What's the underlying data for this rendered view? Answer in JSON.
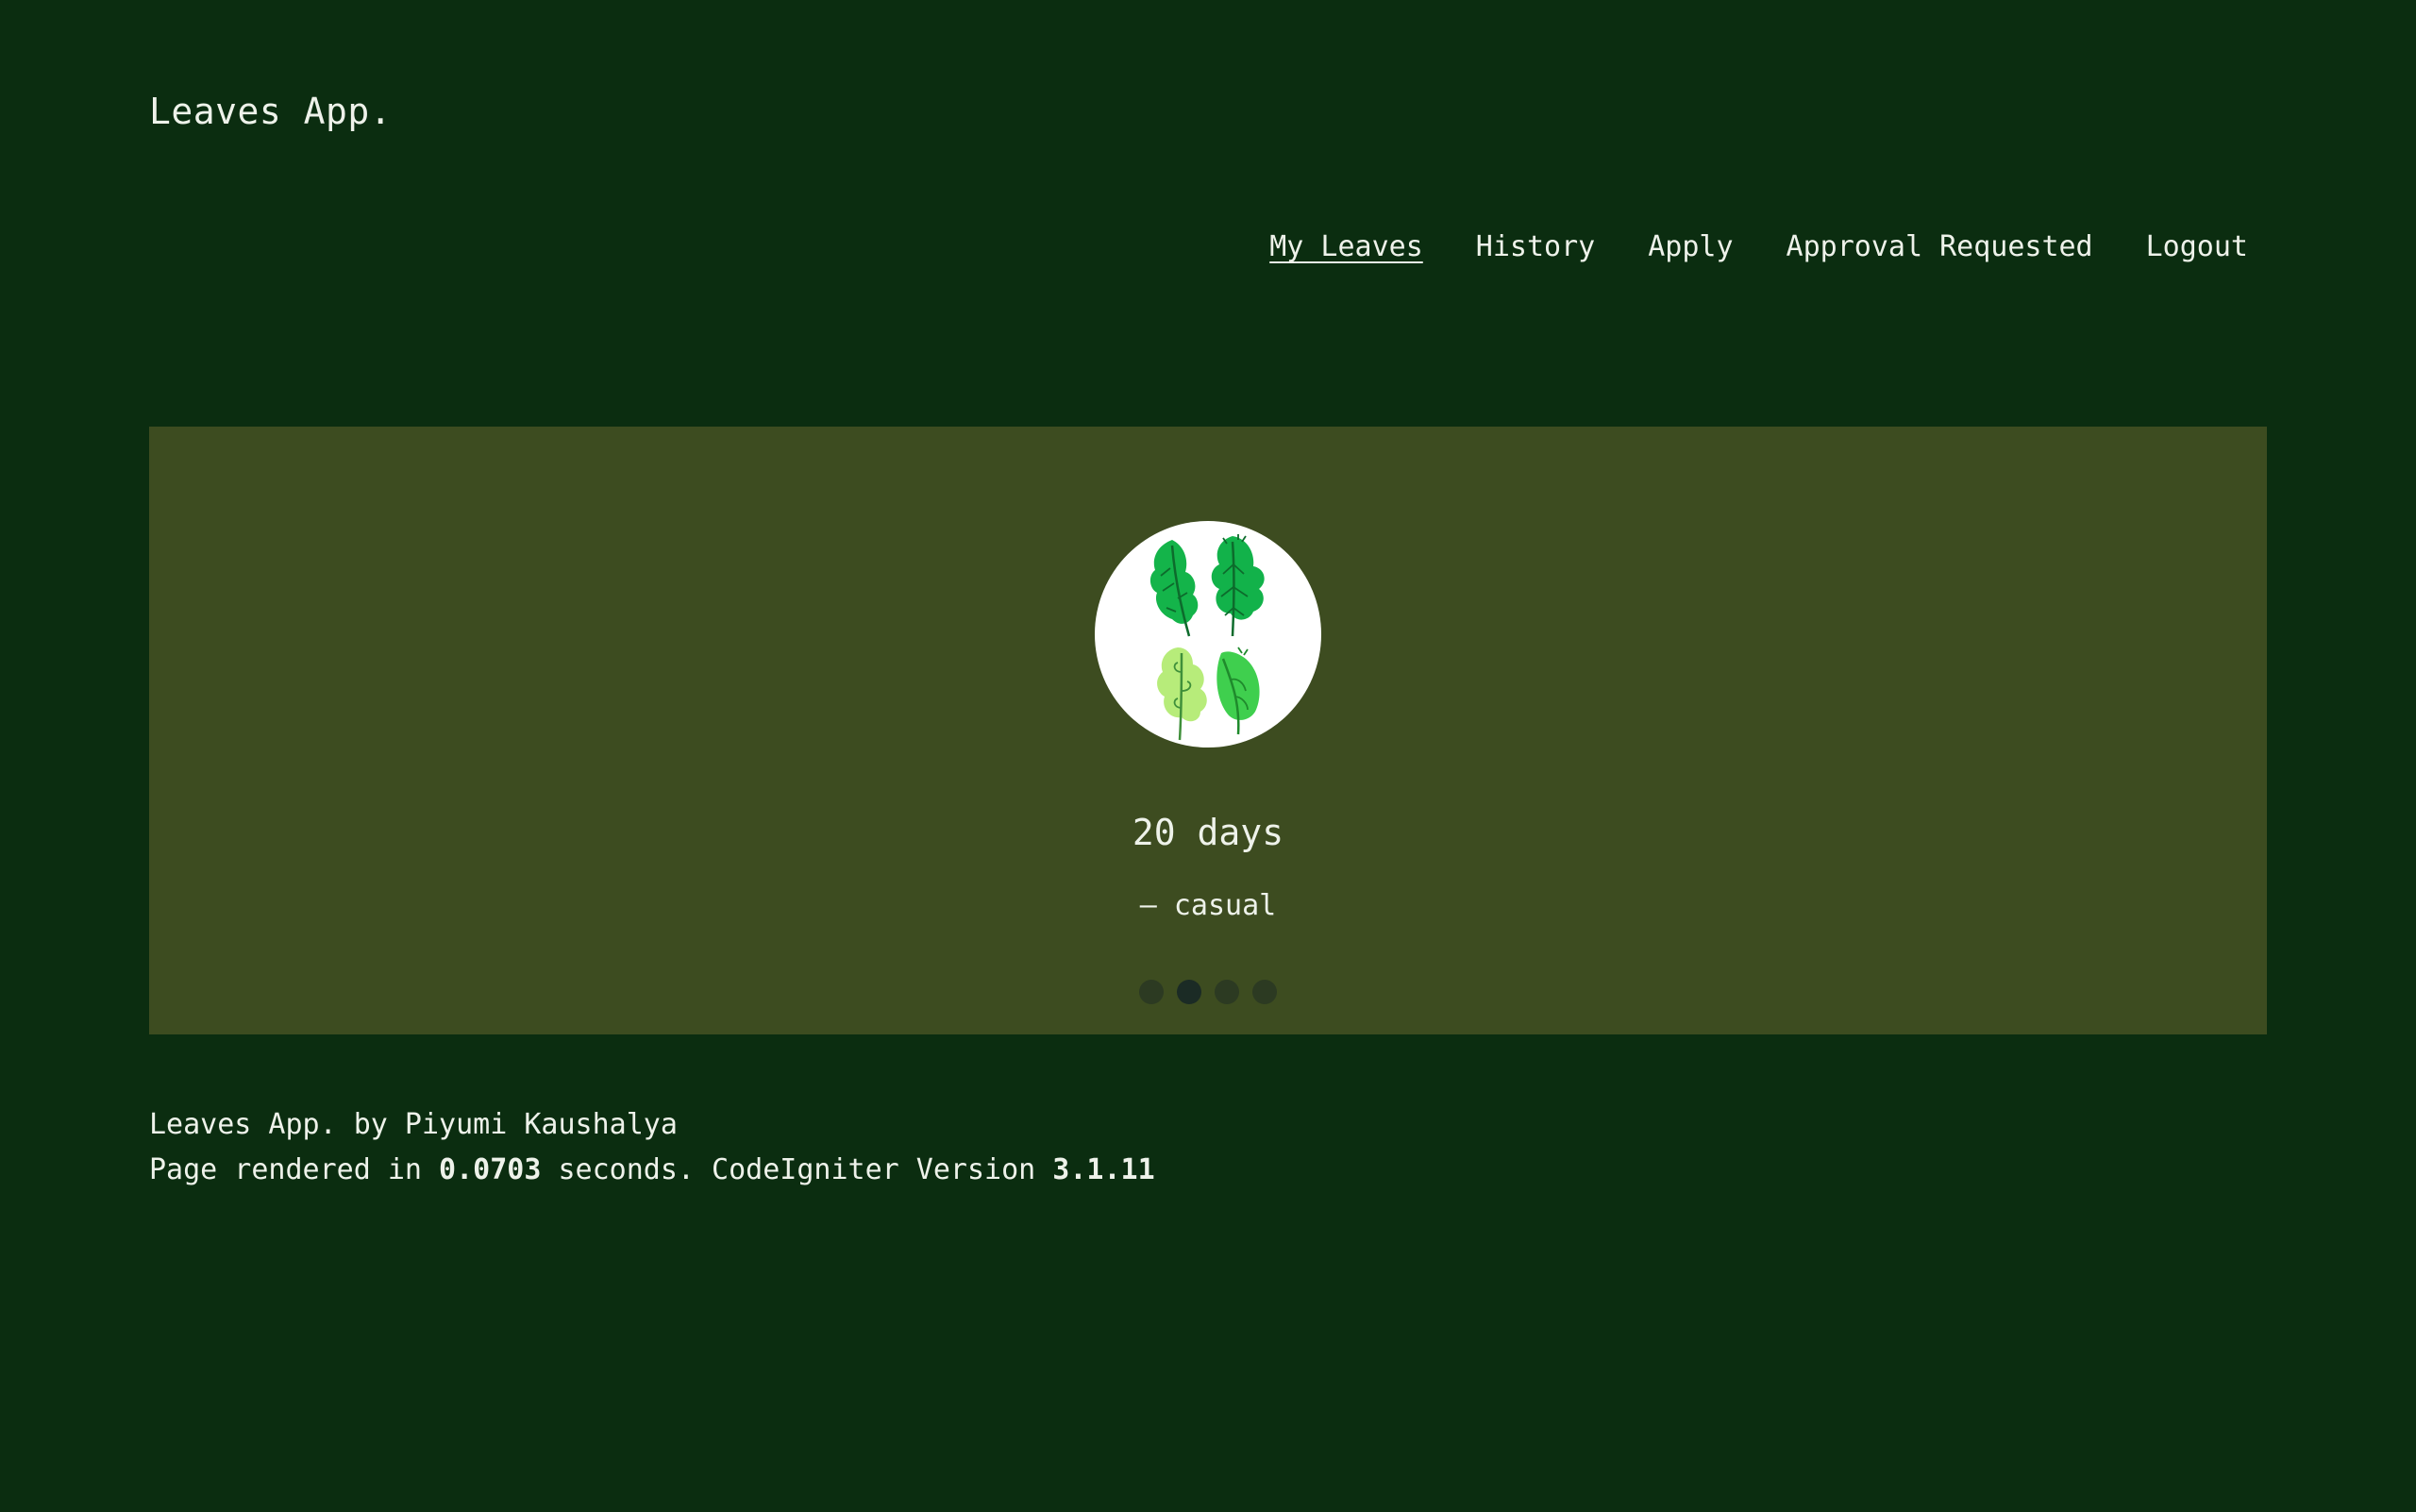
{
  "brand": {
    "title": "Leaves App."
  },
  "nav": {
    "items": [
      {
        "label": "My Leaves",
        "active": true
      },
      {
        "label": "History"
      },
      {
        "label": "Apply"
      },
      {
        "label": "Approval Requested"
      },
      {
        "label": "Logout"
      }
    ]
  },
  "hero": {
    "image_icon": "leaves-illustration",
    "days_text": "20 days",
    "leave_type_text": "— casual",
    "carousel": {
      "total": 4,
      "active_index": 1
    }
  },
  "footer": {
    "credit": "Leaves App. by Piyumi Kaushalya",
    "rendered_prefix": "Page rendered in ",
    "render_time": "0.0703",
    "rendered_mid": " seconds. CodeIgniter Version ",
    "version": "3.1.11"
  },
  "colors": {
    "background": "#0b2d10",
    "hero_background": "#3d4c20",
    "text": "#eef2ea"
  }
}
